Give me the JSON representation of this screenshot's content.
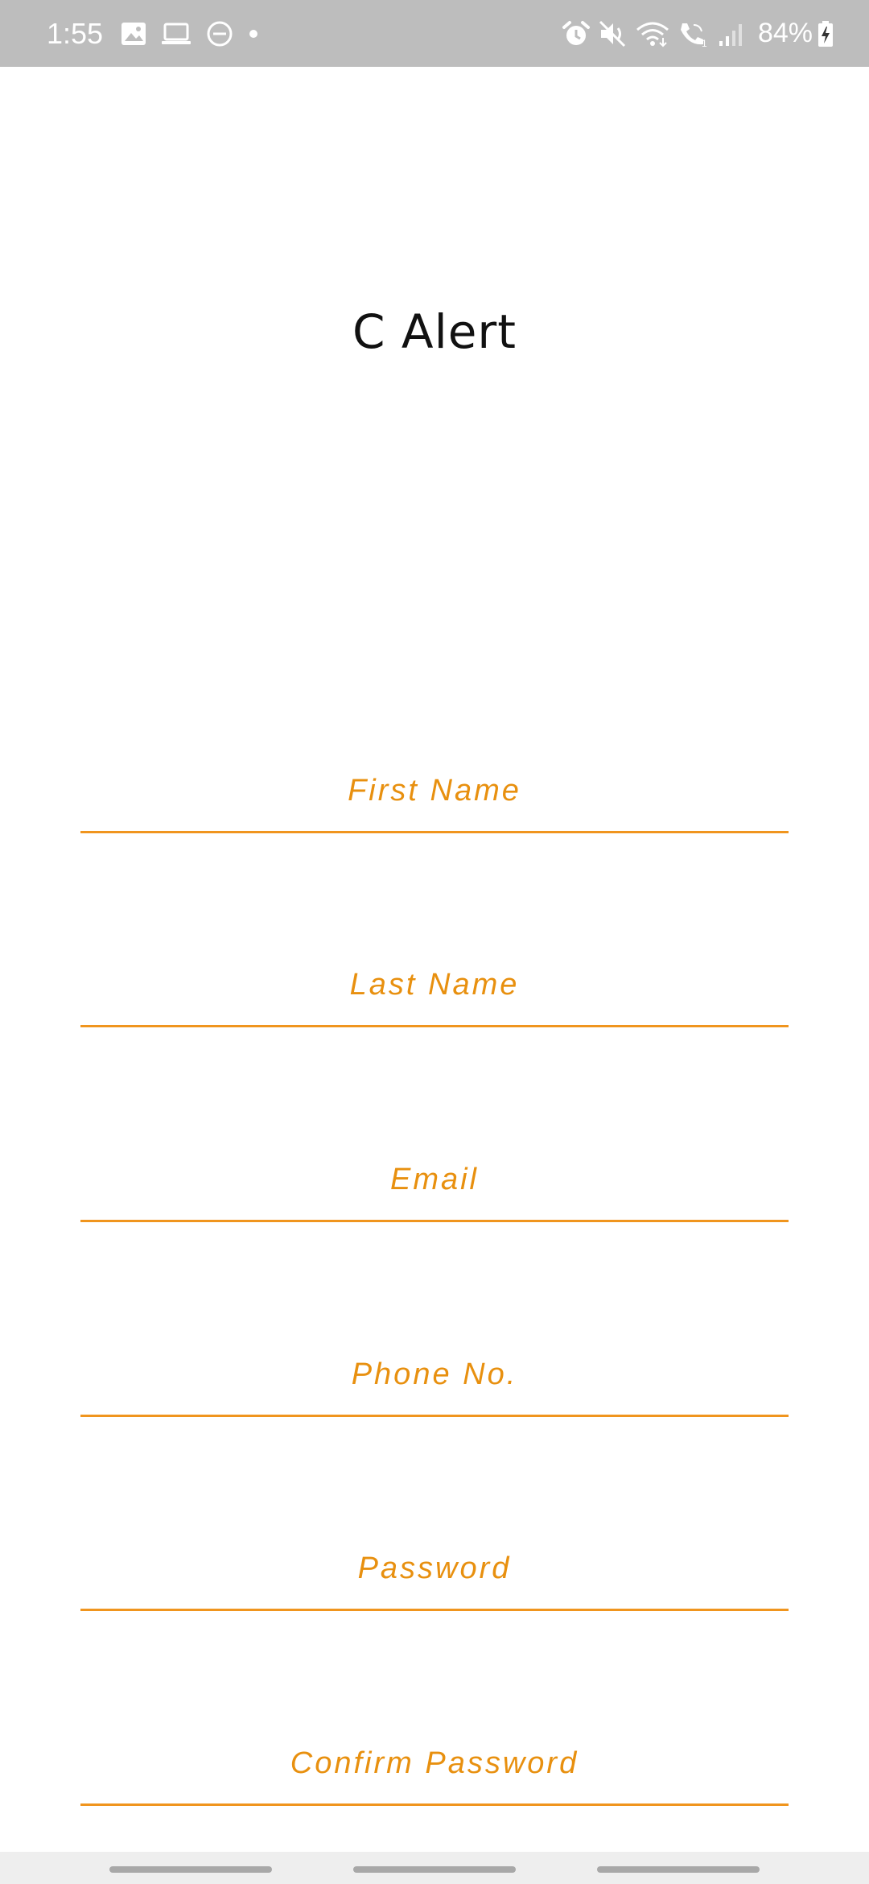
{
  "status_bar": {
    "time": "1:55",
    "battery_percent": "84%",
    "left_icons": [
      "image-icon",
      "laptop-icon",
      "do-not-disturb-icon",
      "dot-icon"
    ],
    "right_icons": [
      "alarm-icon",
      "mute-icon",
      "wifi-icon",
      "wifi-calling-icon",
      "signal-icon",
      "battery-charging-icon"
    ],
    "background_color": "#bdbdbd"
  },
  "app": {
    "title": "C Alert"
  },
  "form": {
    "accent_color": "#f0951e",
    "fields": [
      {
        "placeholder": "First Name",
        "value": ""
      },
      {
        "placeholder": "Last Name",
        "value": ""
      },
      {
        "placeholder": "Email",
        "value": ""
      },
      {
        "placeholder": "Phone No.",
        "value": ""
      },
      {
        "placeholder": "Password",
        "value": ""
      },
      {
        "placeholder": "Confirm Password",
        "value": ""
      }
    ]
  },
  "nav_bar": {
    "buttons": [
      "recents-button",
      "home-button",
      "back-button"
    ]
  }
}
